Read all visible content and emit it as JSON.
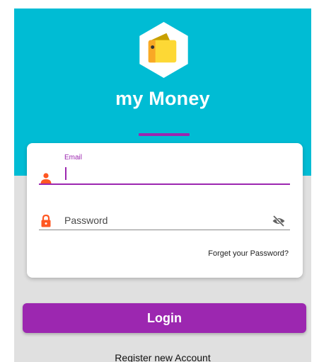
{
  "app": {
    "title": "my Money",
    "logo_icon": "wallet-icon"
  },
  "colors": {
    "header_background": "#00bcd4",
    "accent": "#9c27b0",
    "icon_orange": "#ff5722",
    "logo_yellow": "#fdd835",
    "screen_background": "#e0e0e0"
  },
  "login_form": {
    "email": {
      "label": "Email",
      "value": "",
      "icon": "person-icon"
    },
    "password": {
      "placeholder": "Password",
      "icon": "lock-icon",
      "toggle_icon": "visibility-off-icon"
    },
    "forgot_password": "Forget your Password?"
  },
  "actions": {
    "login_label": "Login",
    "register_label": "Register new Account"
  }
}
